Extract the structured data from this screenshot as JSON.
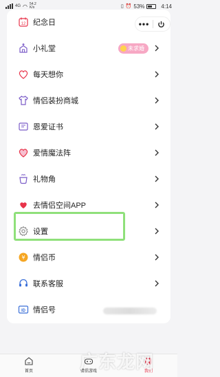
{
  "status_bar": {
    "signal": "4G",
    "net_speed_value": "54.2",
    "net_speed_unit": "K/s",
    "battery": "53%",
    "time": "4:14"
  },
  "mini_program": {
    "more": "•••"
  },
  "menu": [
    {
      "label": "纪念日",
      "icon": "calendar-heart-icon"
    },
    {
      "label": "小礼堂",
      "icon": "chapel-icon",
      "badge": "未求婚"
    },
    {
      "label": "每天想你",
      "icon": "heart-icon"
    },
    {
      "label": "情侣装扮商城",
      "icon": "tshirt-icon"
    },
    {
      "label": "恩爱证书",
      "icon": "certificate-icon"
    },
    {
      "label": "爱情魔法阵",
      "icon": "heart-magic-icon"
    },
    {
      "label": "礼物角",
      "icon": "gift-cup-icon"
    },
    {
      "label": "去情侣空间APP",
      "icon": "heart-app-icon"
    },
    {
      "label": "设置",
      "icon": "gear-icon"
    },
    {
      "label": "情侣币",
      "icon": "coin-icon"
    },
    {
      "label": "联系客服",
      "icon": "headset-icon"
    },
    {
      "label": "情侣号",
      "icon": "id-card-icon"
    }
  ],
  "tab_bar": {
    "tabs": [
      {
        "label": "首页",
        "icon": "home-icon"
      },
      {
        "label": "情侣游戏",
        "icon": "game-icon"
      },
      {
        "label": "我们",
        "icon": "couple-icon"
      }
    ]
  },
  "watermark": "广东龙网",
  "colors": {
    "accent_red": "#e8334a",
    "icon_purple": "#7b5cc8",
    "badge_pink": "#f7a8c4",
    "highlight_green": "#8fe07a"
  }
}
